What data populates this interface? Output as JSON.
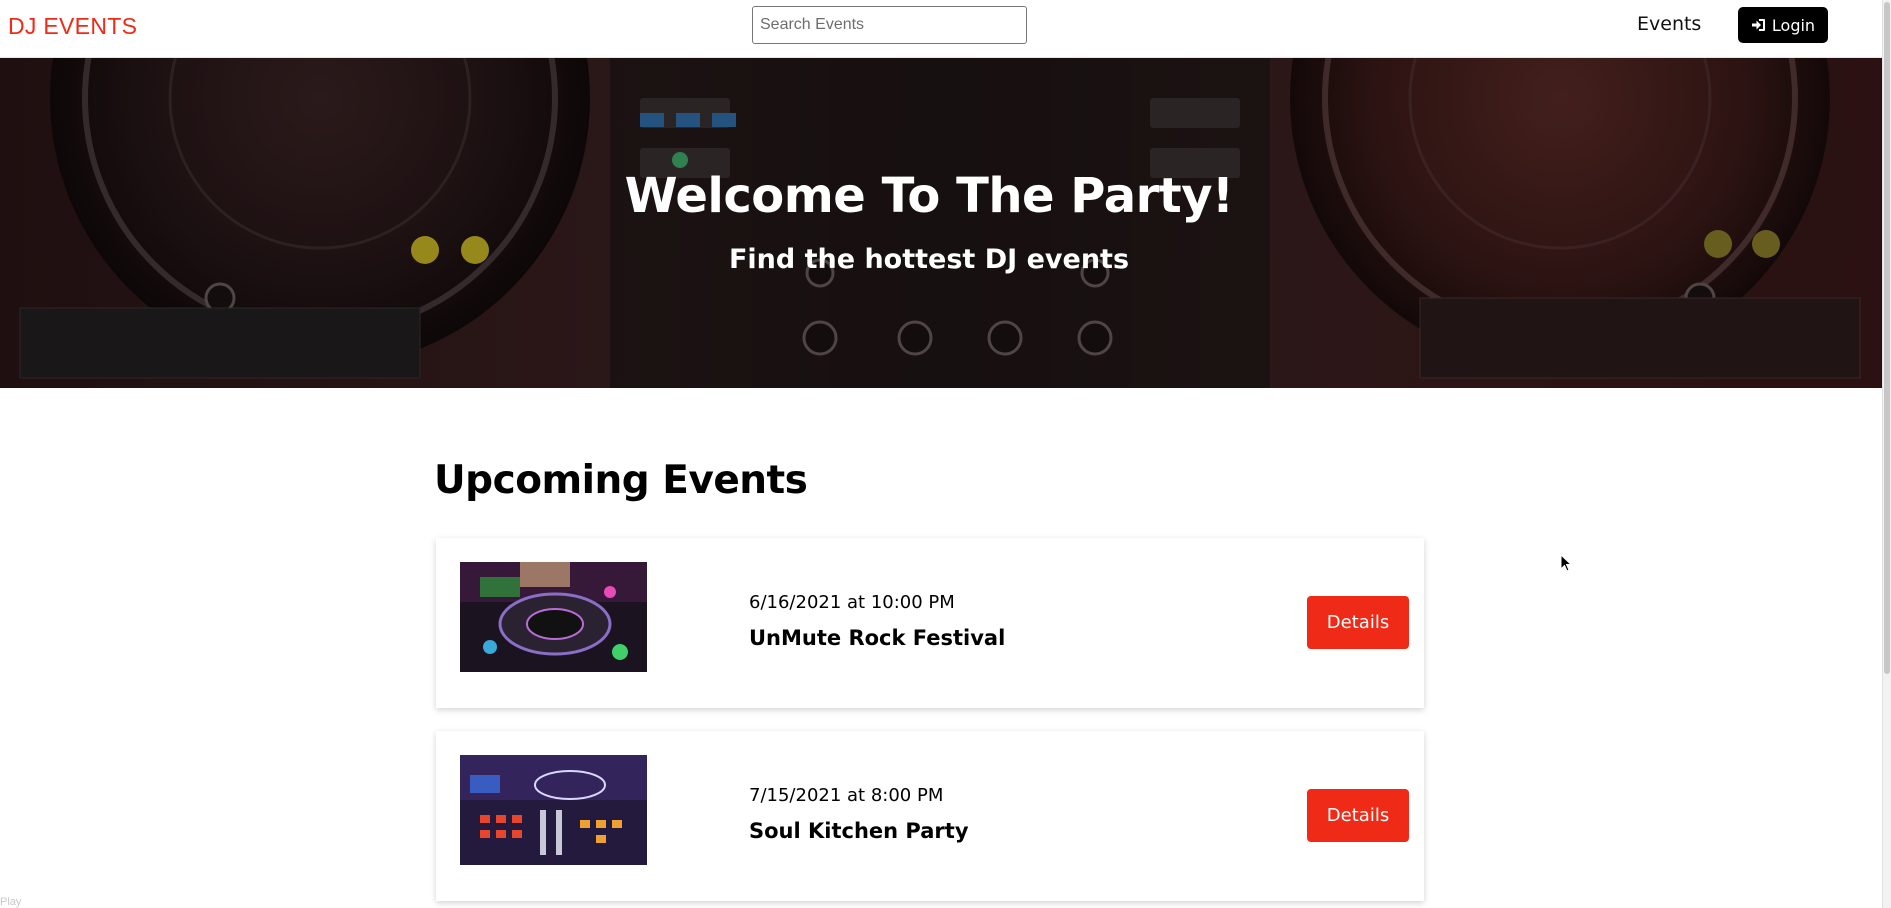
{
  "header": {
    "logo": "DJ EVENTS",
    "search_placeholder": "Search Events",
    "nav_events": "Events",
    "login_label": "Login"
  },
  "hero": {
    "title": "Welcome To The Party!",
    "subtitle": "Find the hottest DJ events"
  },
  "main": {
    "section_title": "Upcoming Events",
    "events": [
      {
        "date": "6/16/2021 at 10:00 PM",
        "name": "UnMute Rock Festival",
        "button": "Details"
      },
      {
        "date": "7/15/2021 at 8:00 PM",
        "name": "Soul Kitchen Party",
        "button": "Details"
      }
    ]
  },
  "footer": {
    "play_label": "Play"
  },
  "colors": {
    "accent": "#ef2a17",
    "login_bg": "#000000"
  }
}
